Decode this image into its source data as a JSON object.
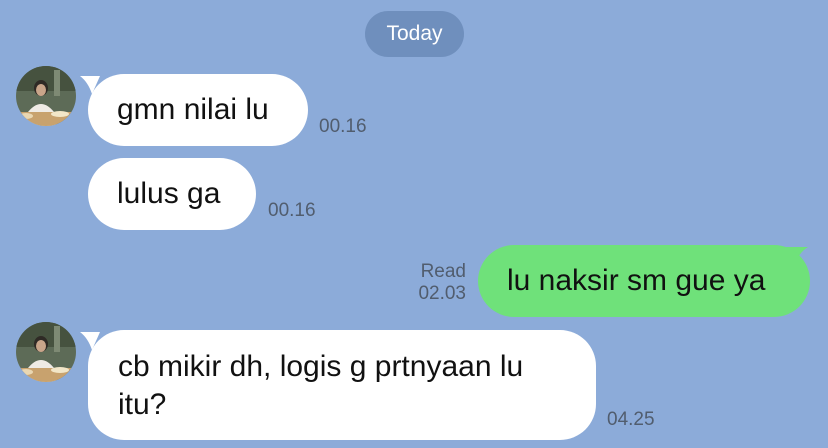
{
  "date_separator": "Today",
  "messages": [
    {
      "text": "gmn nilai lu",
      "time": "00.16"
    },
    {
      "text": "lulus ga",
      "time": "00.16"
    },
    {
      "text": "lu naksir sm gue ya",
      "time": "02.03",
      "status": "Read"
    },
    {
      "text": "cb mikir dh, logis g prtnyaan lu itu?",
      "time": "04.25"
    }
  ],
  "colors": {
    "background": "#8cabd9",
    "received_bubble": "#ffffff",
    "sent_bubble": "#6fe17a",
    "date_pill": "#6f8fbd"
  }
}
